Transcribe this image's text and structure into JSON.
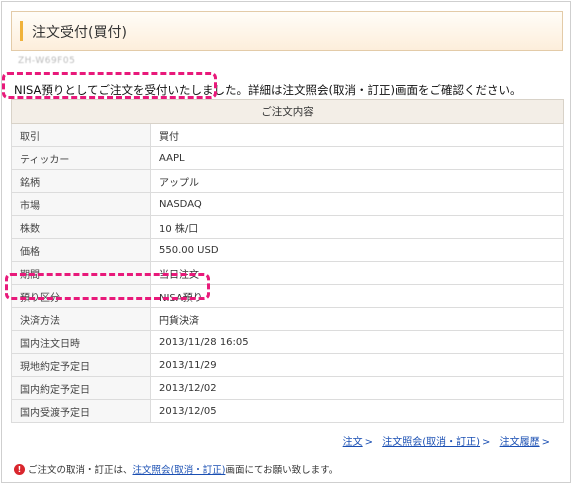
{
  "header": {
    "title": "注文受付(買付)"
  },
  "order_id": "ZH-W69F05",
  "message": "NISA預りとしてご注文を受付いたしました。詳細は注文照会(取消・訂正)画面をご確認ください。",
  "table": {
    "title": "ご注文内容",
    "rows": [
      {
        "label": "取引",
        "value": "買付"
      },
      {
        "label": "ティッカー",
        "value": "AAPL"
      },
      {
        "label": "銘柄",
        "value": "アップル"
      },
      {
        "label": "市場",
        "value": "NASDAQ"
      },
      {
        "label": "株数",
        "value": "10 株/口"
      },
      {
        "label": "価格",
        "value": "550.00 USD"
      },
      {
        "label": "期間",
        "value": "当日注文"
      },
      {
        "label": "預り区分",
        "value": "NISA預り"
      },
      {
        "label": "決済方法",
        "value": "円貨決済"
      },
      {
        "label": "国内注文日時",
        "value": "2013/11/28 16:05"
      },
      {
        "label": "現地約定予定日",
        "value": "2013/11/29"
      },
      {
        "label": "国内約定予定日",
        "value": "2013/12/02"
      },
      {
        "label": "国内受渡予定日",
        "value": "2013/12/05"
      }
    ]
  },
  "links": {
    "order": "注文",
    "inquiry": "注文照会(取消・訂正)",
    "history": "注文履歴",
    "arrow": ">"
  },
  "note": {
    "icon": "warning-icon",
    "prefix": "ご注文の取消・訂正は、",
    "link": "注文照会(取消・訂正)",
    "suffix": "画面にてお願い致します。"
  },
  "colors": {
    "highlight": "#e8197a",
    "accent": "#f0b23a",
    "link": "#1a4fb3",
    "warning": "#d9262d"
  }
}
